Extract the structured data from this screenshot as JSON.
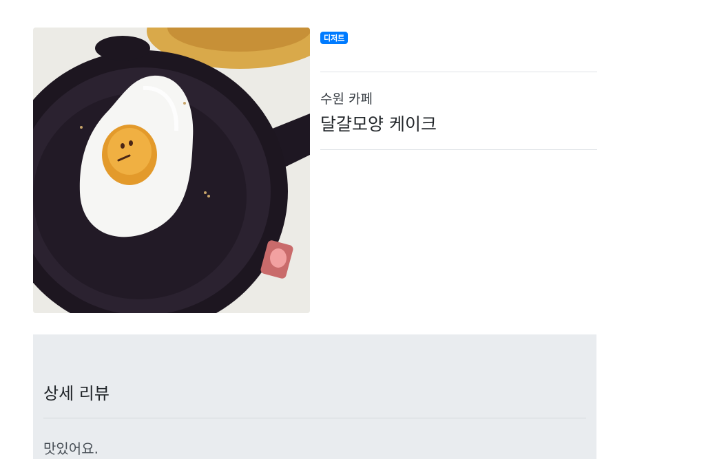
{
  "product": {
    "image_alt": "달걀모양 케이크 사진",
    "category_badge": "디저트",
    "store_name": "수원 카페",
    "menu_name": "달걀모양 케이크"
  },
  "review": {
    "title": "상세 리뷰",
    "body": "맛있어요."
  },
  "colors": {
    "badge_bg": "#007bff",
    "review_bg": "#e9ecef",
    "divider": "#dee2e6"
  }
}
